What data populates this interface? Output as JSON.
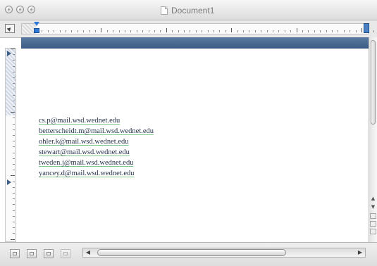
{
  "window": {
    "title": "Document1",
    "buttons": [
      "close-button",
      "minimize-button",
      "zoom-button"
    ]
  },
  "document": {
    "lines": [
      "cs.p@mail.wsd.wednet.edu",
      "betterscheidt.m@mail.wsd.wednet.edu",
      "ohler.k@mail.wsd.wednet.edu",
      "stewart@mail.wsd.wednet.edu",
      "tweden.j@mail.wsd.wednet.edu",
      "yancey.d@mail.wsd.wednet.edu"
    ]
  },
  "icons": {
    "close": "close-icon",
    "minimize": "minimize-icon",
    "zoom": "zoom-icon",
    "document": "document-icon",
    "ruler_toggle": "ruler-toggle-icon",
    "scroll_left": "arrow-left-icon",
    "scroll_right": "arrow-right-icon",
    "scroll_up": "arrow-up-icon",
    "scroll_down": "arrow-down-icon"
  },
  "colors": {
    "accent_blue_band": "#4a6a93",
    "ruler_marker": "#2f79d8",
    "link_underline": "#7fc98a",
    "text": "#26324a"
  }
}
